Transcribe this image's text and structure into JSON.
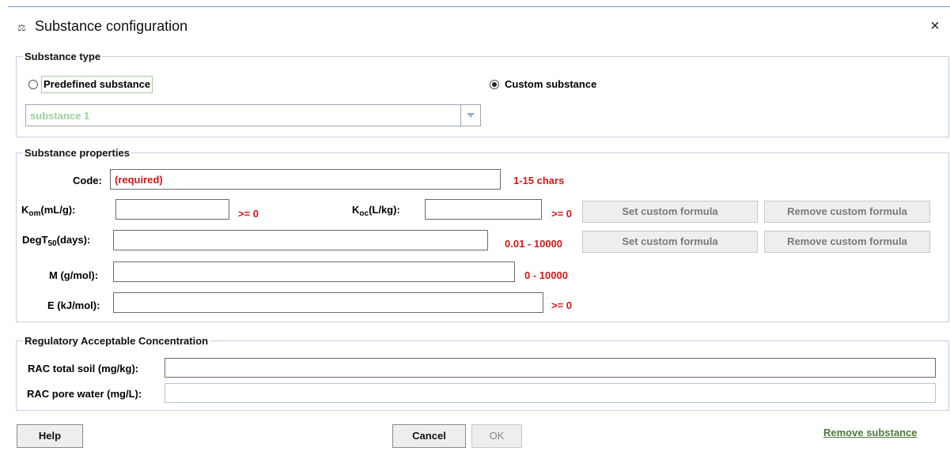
{
  "window": {
    "title": "Substance configuration",
    "close_glyph": "×"
  },
  "substance_type": {
    "legend": "Substance type",
    "predefined_label": "Predefined substance",
    "custom_label": "Custom substance",
    "selected": "custom",
    "dropdown_value": "substance 1"
  },
  "properties": {
    "legend": "Substance properties",
    "code": {
      "label": "Code:",
      "value": "(required)",
      "hint": "1-15 chars"
    },
    "kom": {
      "label_main": "K",
      "label_sub": "om",
      "label_unit": "(mL/g):",
      "value": "",
      "hint": ">= 0"
    },
    "koc": {
      "label_main": "K",
      "label_sub": "oc",
      "label_unit": "(L/kg):",
      "value": "",
      "hint": ">= 0"
    },
    "degt50": {
      "label_main": "DegT",
      "label_sub": "50",
      "label_unit": "(days):",
      "value": "",
      "hint": "0.01 - 10000"
    },
    "m": {
      "label": "M (g/mol):",
      "value": "",
      "hint": "0 - 10000"
    },
    "e": {
      "label": "E (kJ/mol):",
      "value": "",
      "hint": ">= 0"
    },
    "set_formula_label": "Set custom formula",
    "remove_formula_label": "Remove custom formula"
  },
  "rac": {
    "legend": "Regulatory Acceptable Concentration",
    "soil_label": "RAC total soil (mg/kg):",
    "soil_value": "",
    "water_label": "RAC pore water (mg/L):",
    "water_value": ""
  },
  "footer": {
    "help_label": "Help",
    "cancel_label": "Cancel",
    "ok_label": "OK",
    "remove_substance_label": "Remove substance"
  },
  "colors": {
    "error": "#d11818",
    "link": "#4a7a3a",
    "disabled_text": "#9cd19c"
  }
}
